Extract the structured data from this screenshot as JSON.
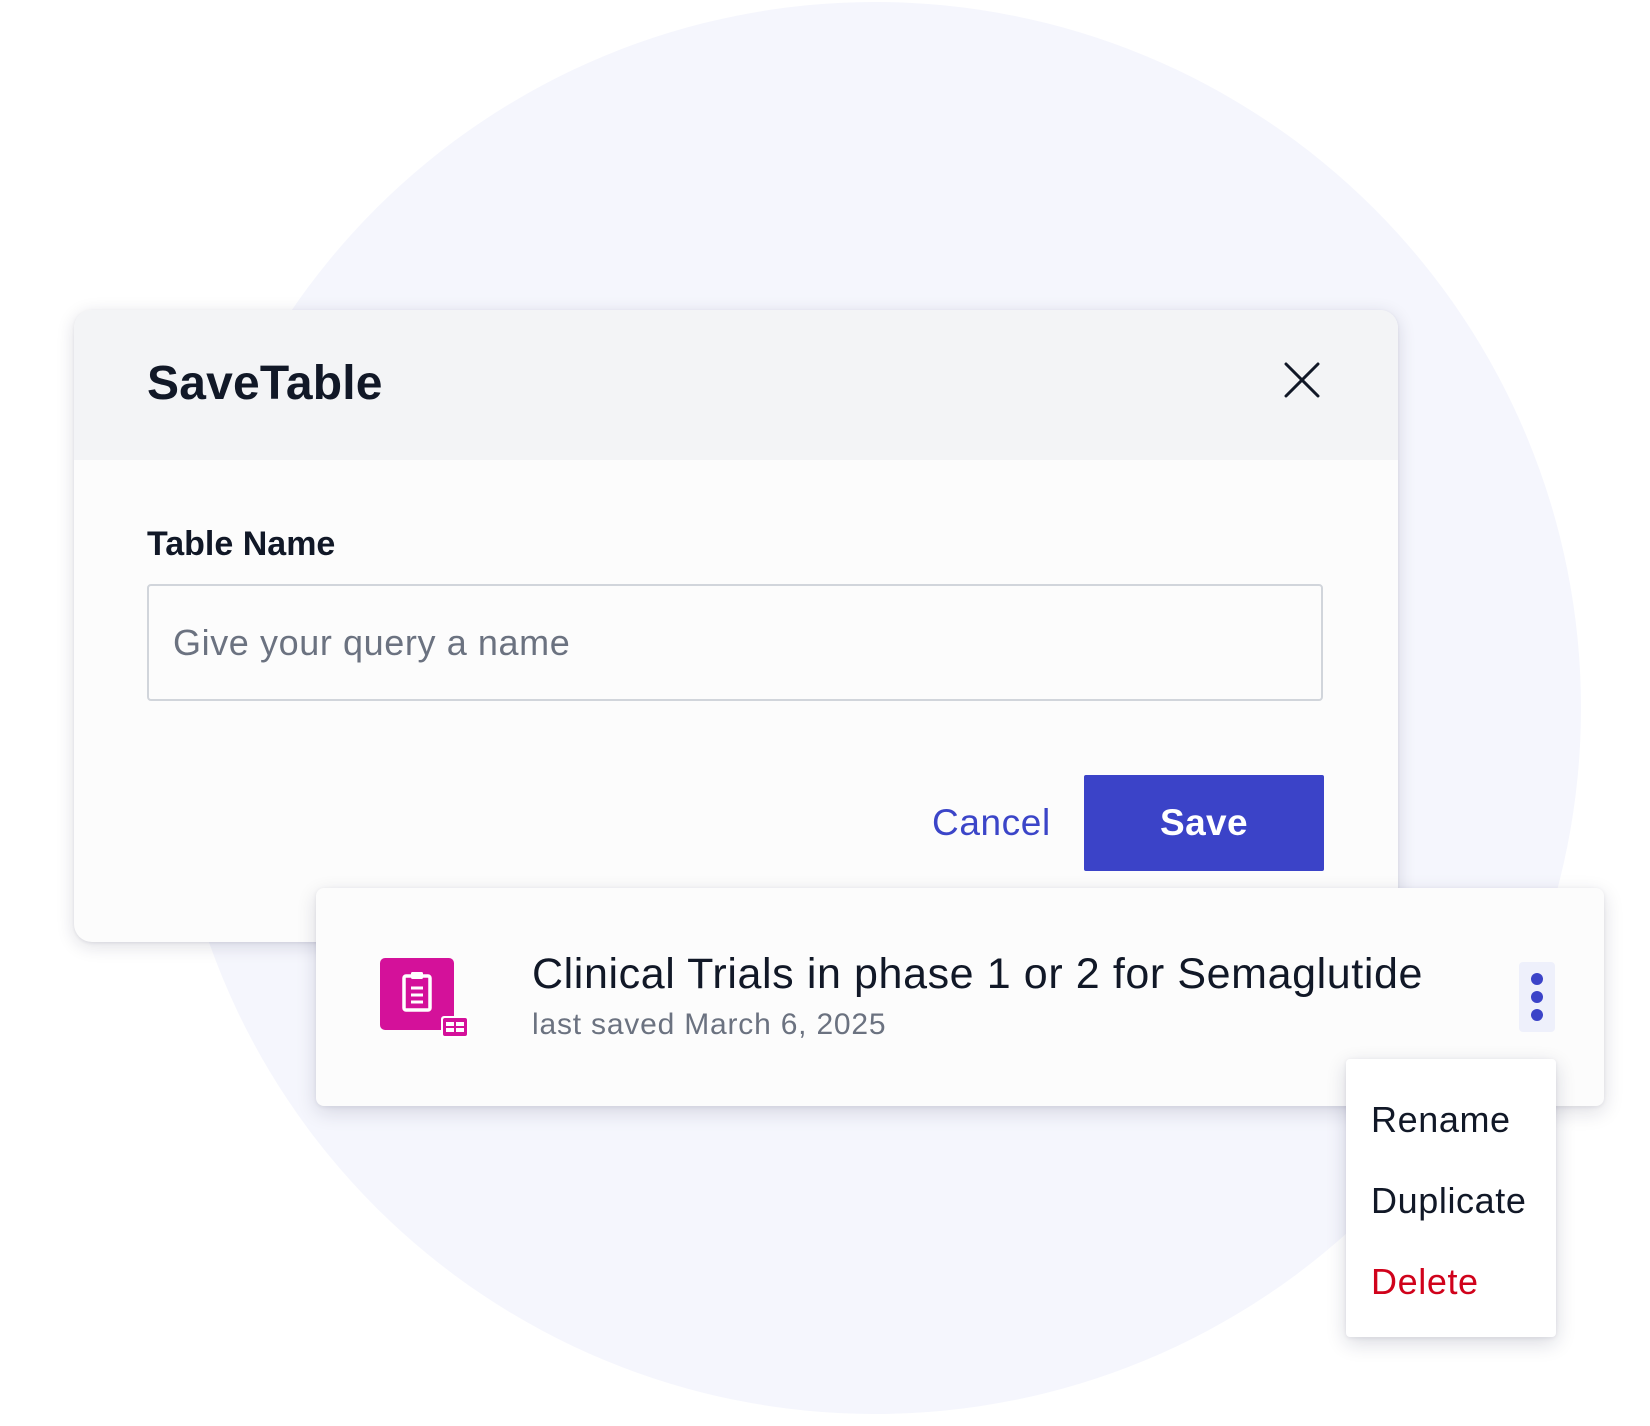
{
  "dialog": {
    "title": "SaveTable",
    "close_icon": "close-icon",
    "field_label": "Table Name",
    "input": {
      "value": "",
      "placeholder": "Give your query a name"
    },
    "cancel_label": "Cancel",
    "save_label": "Save"
  },
  "saved_item": {
    "icon": "clipboard-table-icon",
    "title": "Clinical Trials in phase 1 or 2 for Semaglutide",
    "meta": "last saved March 6, 2025",
    "more_icon": "kebab-menu-icon"
  },
  "context_menu": {
    "items": [
      {
        "label": "Rename"
      },
      {
        "label": "Duplicate"
      },
      {
        "label": "Delete"
      }
    ]
  },
  "colors": {
    "primary": "#3b43c8",
    "icon_magenta": "#d4119a",
    "danger": "#d0021b",
    "background_circle": "#f5f6fd",
    "header_gray": "#f3f4f6"
  }
}
